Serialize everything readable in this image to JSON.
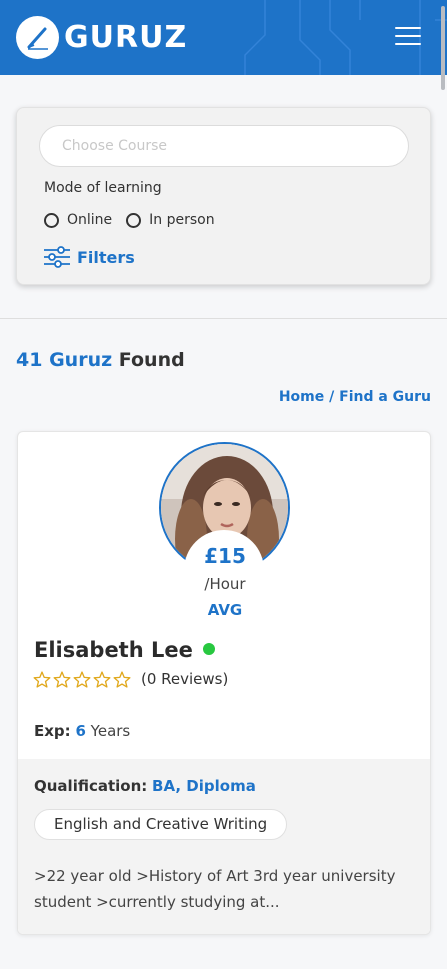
{
  "header": {
    "brand": "GURUZ",
    "menu_icon": "hamburger-menu-icon",
    "color": "#1e73c8"
  },
  "search": {
    "course_placeholder": "Choose Course",
    "course_value": "",
    "mode_label": "Mode of learning",
    "mode_options": [
      "Online",
      "In person"
    ],
    "filters_label": "Filters"
  },
  "results": {
    "count": "41",
    "brand_word": "Guruz",
    "found_word": "Found",
    "breadcrumb": {
      "home": "Home",
      "separator": " / ",
      "current": "Find a Guru"
    }
  },
  "tutor": {
    "name": "Elisabeth Lee",
    "status": "online",
    "price": "£15",
    "per": "/Hour",
    "avg_label": "AVG",
    "rating_stars": 0,
    "rating_max": 5,
    "reviews": "(0 Reviews)",
    "exp_label": "Exp:",
    "exp_value": "6",
    "exp_unit": "Years",
    "qualification_label": "Qualification:",
    "qualification_value": "BA, Diploma",
    "subject": "English and Creative Writing",
    "bio": ">22 year old >History of Art 3rd year university student >currently studying at..."
  },
  "colors": {
    "accent": "#1e73c8",
    "online": "#28c840"
  }
}
